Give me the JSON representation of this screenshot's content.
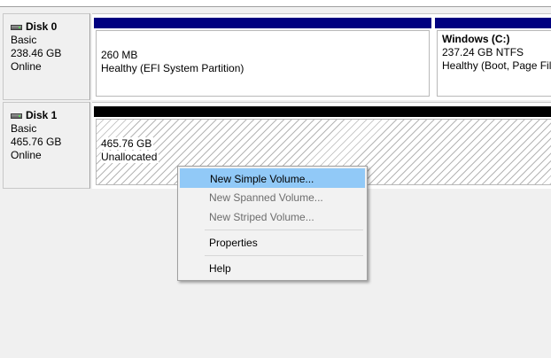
{
  "disks": [
    {
      "name": "Disk 0",
      "type": "Basic",
      "size": "238.46 GB",
      "status": "Online",
      "partitions": [
        {
          "title": "",
          "line1": "260 MB",
          "line2": "Healthy (EFI System Partition)",
          "bar_color": "#000080",
          "hatched": false
        },
        {
          "title": "Windows  (C:)",
          "line1": "237.24 GB NTFS",
          "line2": "Healthy (Boot, Page File",
          "bar_color": "#000080",
          "hatched": false
        }
      ]
    },
    {
      "name": "Disk 1",
      "type": "Basic",
      "size": "465.76 GB",
      "status": "Online",
      "partitions": [
        {
          "title": "",
          "line1": "465.76 GB",
          "line2": "Unallocated",
          "bar_color": "#000000",
          "hatched": true
        }
      ]
    }
  ],
  "context_menu": {
    "items": [
      {
        "label": "New Simple Volume...",
        "enabled": true,
        "highlighted": true
      },
      {
        "label": "New Spanned Volume...",
        "enabled": false,
        "highlighted": false
      },
      {
        "label": "New Striped Volume...",
        "enabled": false,
        "highlighted": false
      },
      {
        "label": "Properties",
        "enabled": true,
        "highlighted": false
      },
      {
        "label": "Help",
        "enabled": true,
        "highlighted": false
      }
    ]
  },
  "colors": {
    "highlight": "#91c9f7",
    "primary_partition_bar": "#000080",
    "unallocated_bar": "#000000"
  },
  "icons": {
    "disk": "disk-drive-icon"
  }
}
